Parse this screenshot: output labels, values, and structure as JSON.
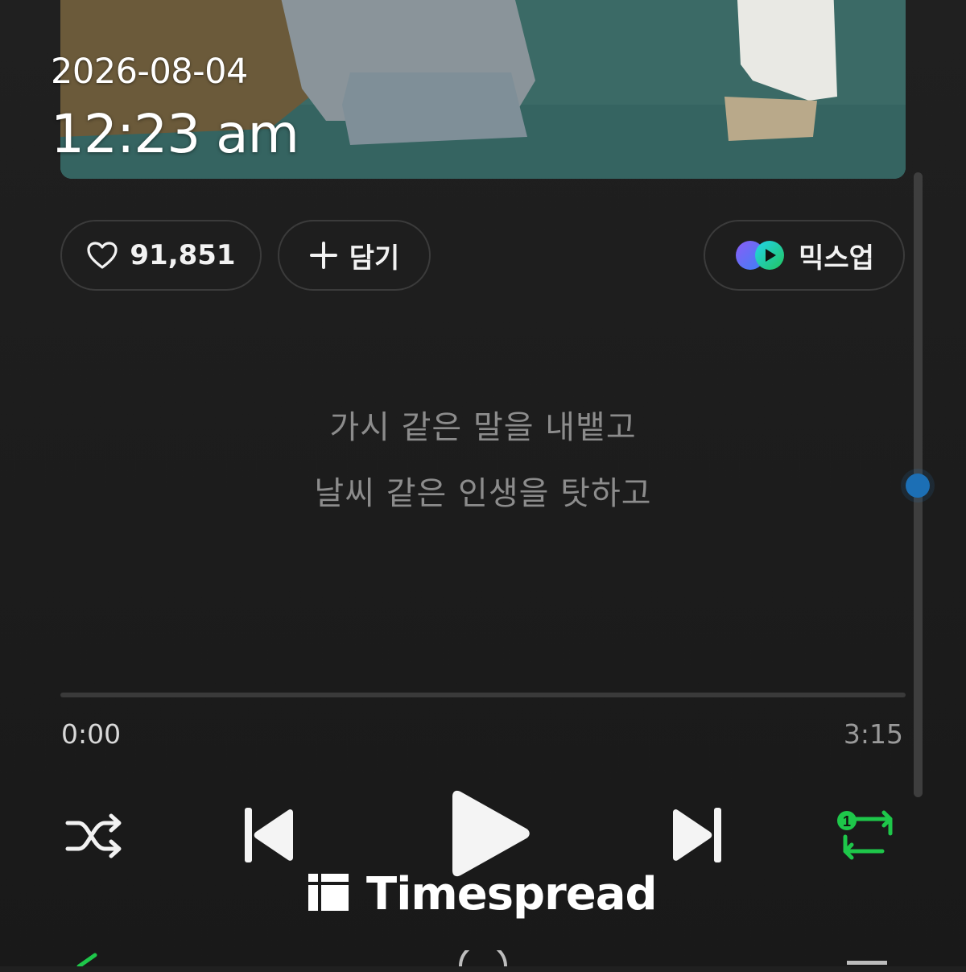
{
  "overlay": {
    "date": "2026-08-04",
    "time": "12:23 am"
  },
  "actions": {
    "like_count": "91,851",
    "add_label": "담기",
    "mixup_label": "믹스업"
  },
  "lyrics": {
    "line1": "가시 같은 말을 내뱉고",
    "line2": "날씨 같은 인생을 탓하고"
  },
  "playback": {
    "current_time": "0:00",
    "total_time": "3:15",
    "progress": 0,
    "repeat_badge": "1"
  },
  "watermark": {
    "text": "Timespread"
  },
  "colors": {
    "background": "#1e1e1e",
    "accent_green": "#1ec74a",
    "scroll_thumb": "#1c6fb5"
  },
  "icons": [
    "heart-icon",
    "plus-icon",
    "mixup-logo-icon",
    "shuffle-icon",
    "previous-icon",
    "play-icon",
    "next-icon",
    "repeat-one-icon"
  ]
}
